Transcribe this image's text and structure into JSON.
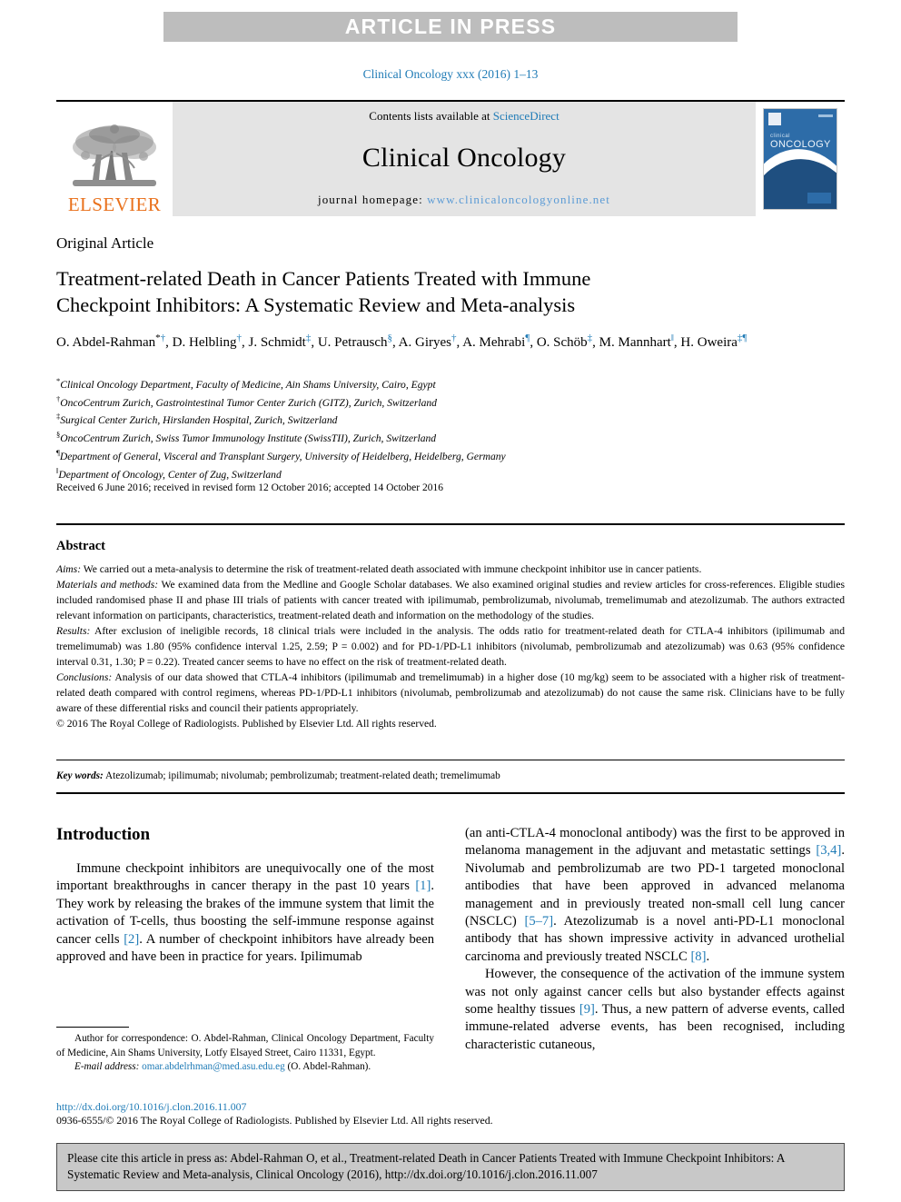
{
  "banner": {
    "text": "ARTICLE IN PRESS"
  },
  "citation_line": "Clinical Oncology xxx (2016) 1–13",
  "masthead": {
    "publisher": "ELSEVIER",
    "contents_prefix": "Contents lists available at ",
    "contents_link": "ScienceDirect",
    "journal_title": "Clinical Oncology",
    "homepage_prefix": "journal homepage: ",
    "homepage_url": "www.clinicaloncologyonline.net",
    "cover": {
      "small_caption": "clinical",
      "large_caption": "ONCOLOGY"
    }
  },
  "article": {
    "type": "Original Article",
    "title_line1": "Treatment-related Death in Cancer Patients Treated with Immune",
    "title_line2": "Checkpoint Inhibitors: A Systematic Review and Meta-analysis",
    "authors": [
      {
        "name": "O. Abdel-Rahman",
        "marks": "*†"
      },
      {
        "name": "D. Helbling",
        "marks": "†"
      },
      {
        "name": "J. Schmidt",
        "marks": "‡"
      },
      {
        "name": "U. Petrausch",
        "marks": "§"
      },
      {
        "name": "A. Giryes",
        "marks": "†"
      },
      {
        "name": "A. Mehrabi",
        "marks": "¶"
      },
      {
        "name": "O. Schöb",
        "marks": "‡"
      },
      {
        "name": "M. Mannhart",
        "marks": "‖"
      },
      {
        "name": "H. Oweira",
        "marks": "‡¶"
      }
    ],
    "affiliations": [
      {
        "mark": "*",
        "text": "Clinical Oncology Department, Faculty of Medicine, Ain Shams University, Cairo, Egypt"
      },
      {
        "mark": "†",
        "text": "OncoCentrum Zurich, Gastrointestinal Tumor Center Zurich (GITZ), Zurich, Switzerland"
      },
      {
        "mark": "‡",
        "text": "Surgical Center Zurich, Hirslanden Hospital, Zurich, Switzerland"
      },
      {
        "mark": "§",
        "text": "OncoCentrum Zurich, Swiss Tumor Immunology Institute (SwissTII), Zurich, Switzerland"
      },
      {
        "mark": "¶",
        "text": "Department of General, Visceral and Transplant Surgery, University of Heidelberg, Heidelberg, Germany"
      },
      {
        "mark": "‖",
        "text": "Department of Oncology, Center of Zug, Switzerland"
      }
    ],
    "received": "Received 6 June 2016; received in revised form 12 October 2016; accepted 14 October 2016"
  },
  "abstract": {
    "heading": "Abstract",
    "aims_label": "Aims:",
    "aims_text": " We carried out a meta-analysis to determine the risk of treatment-related death associated with immune checkpoint inhibitor use in cancer patients.",
    "methods_label": "Materials and methods:",
    "methods_text": " We examined data from the Medline and Google Scholar databases. We also examined original studies and review articles for cross-references. Eligible studies included randomised phase II and phase III trials of patients with cancer treated with ipilimumab, pembrolizumab, nivolumab, tremelimumab and atezolizumab. The authors extracted relevant information on participants, characteristics, treatment-related death and information on the methodology of the studies.",
    "results_label": "Results:",
    "results_text": " After exclusion of ineligible records, 18 clinical trials were included in the analysis. The odds ratio for treatment-related death for CTLA-4 inhibitors (ipilimumab and tremelimumab) was 1.80 (95% confidence interval 1.25, 2.59; P = 0.002) and for PD-1/PD-L1 inhibitors (nivolumab, pembrolizumab and atezolizumab) was 0.63 (95% confidence interval 0.31, 1.30; P = 0.22). Treated cancer seems to have no effect on the risk of treatment-related death.",
    "conclusions_label": "Conclusions:",
    "conclusions_text": " Analysis of our data showed that CTLA-4 inhibitors (ipilimumab and tremelimumab) in a higher dose (10 mg/kg) seem to be associated with a higher risk of treatment-related death compared with control regimens, whereas PD-1/PD-L1 inhibitors (nivolumab, pembrolizumab and atezolizumab) do not cause the same risk. Clinicians have to be fully aware of these differential risks and council their patients appropriately.",
    "copyright": "© 2016 The Royal College of Radiologists. Published by Elsevier Ltd. All rights reserved."
  },
  "keywords": {
    "label": "Key words:",
    "text": " Atezolizumab; ipilimumab; nivolumab; pembrolizumab; treatment-related death; tremelimumab"
  },
  "introduction": {
    "heading": "Introduction",
    "left_p1_a": "Immune checkpoint inhibitors are unequivocally one of the most important breakthroughs in cancer therapy in the past 10 years ",
    "left_ref1": "[1]",
    "left_p1_b": ". They work by releasing the brakes of the immune system that limit the activation of T-cells, thus boosting the self-immune response against cancer cells ",
    "left_ref2": "[2]",
    "left_p1_c": ". A number of checkpoint inhibitors have already been approved and have been in practice for years. Ipilimumab",
    "right_p1_a": "(an anti-CTLA-4 monoclonal antibody) was the first to be approved in melanoma management in the adjuvant and metastatic settings ",
    "right_ref34": "[3,4]",
    "right_p1_b": ". Nivolumab and pembrolizumab are two PD-1 targeted monoclonal antibodies that have been approved in advanced melanoma management and in previously treated non-small cell lung cancer (NSCLC) ",
    "right_ref57": "[5–7]",
    "right_p1_c": ". Atezolizumab is a novel anti-PD-L1 monoclonal antibody that has shown impressive activity in advanced urothelial carcinoma and previously treated NSCLC ",
    "right_ref8": "[8]",
    "right_p1_d": ".",
    "right_p2_a": "However, the consequence of the activation of the immune system was not only against cancer cells but also bystander effects against some healthy tissues ",
    "right_ref9": "[9]",
    "right_p2_b": ". Thus, a new pattern of adverse events, called immune-related adverse events, has been recognised, including characteristic cutaneous,"
  },
  "footnote": {
    "correspondence": "Author for correspondence: O. Abdel-Rahman, Clinical Oncology Department, Faculty of Medicine, Ain Shams University, Lotfy Elsayed Street, Cairo 11331, Egypt.",
    "email_label": "E-mail address:",
    "email": "omar.abdelrhman@med.asu.edu.eg",
    "email_suffix": " (O. Abdel-Rahman)."
  },
  "footer": {
    "doi": "http://dx.doi.org/10.1016/j.clon.2016.11.007",
    "issn": "0936-6555/© 2016 The Royal College of Radiologists. Published by Elsevier Ltd. All rights reserved."
  },
  "cite_box": {
    "text": "Please cite this article in press as: Abdel-Rahman O, et al., Treatment-related Death in Cancer Patients Treated with Immune Checkpoint Inhibitors: A Systematic Review and Meta-analysis, Clinical Oncology (2016), http://dx.doi.org/10.1016/j.clon.2016.11.007"
  },
  "colors": {
    "link": "#1f7bb6",
    "elsevier_orange": "#e9711c",
    "banner_gray": "#bdbdbd",
    "masthead_gray": "#e4e4e4",
    "cite_box_gray": "#c8c8c8"
  }
}
